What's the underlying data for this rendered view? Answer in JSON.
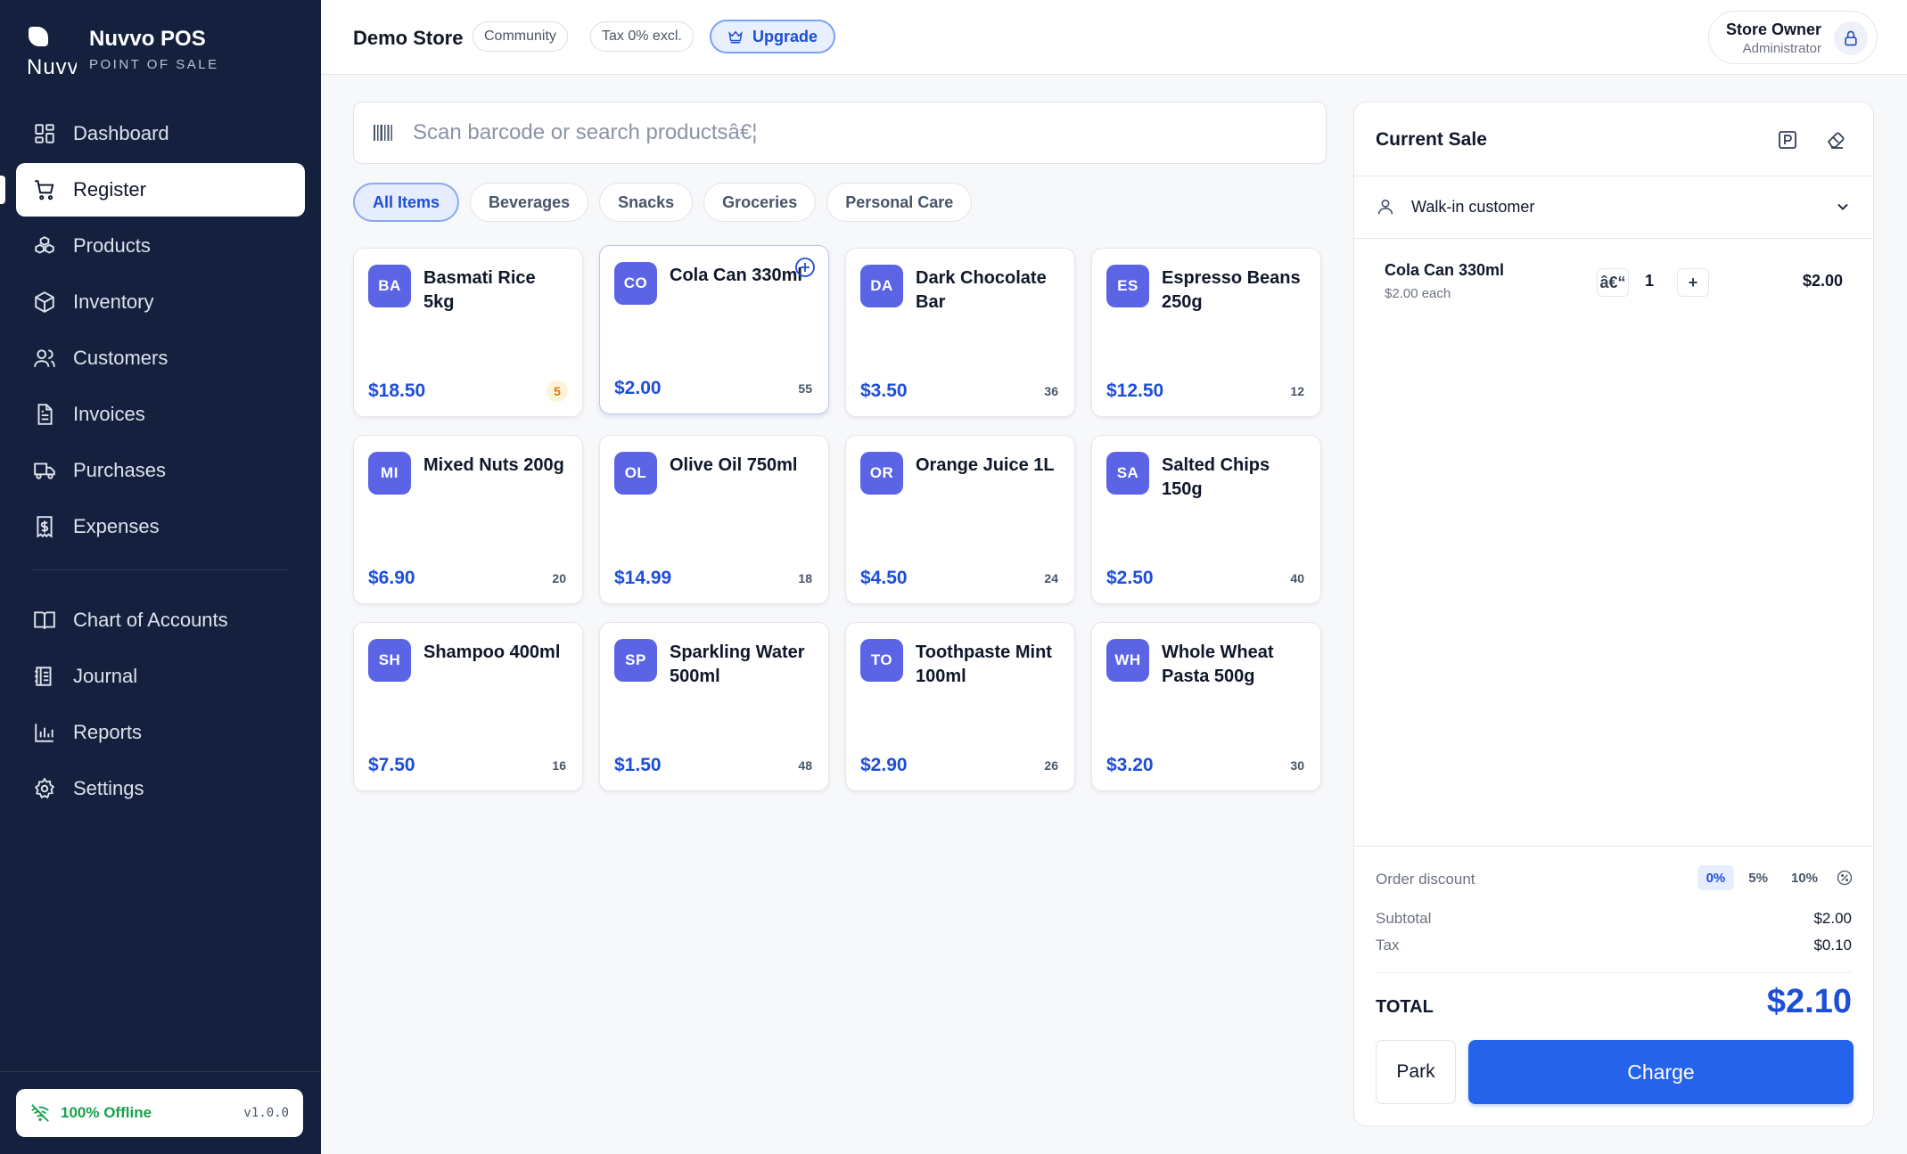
{
  "brand": {
    "logo_text": "Nuvv",
    "name": "Nuvvo POS",
    "subtitle": "POINT OF SALE"
  },
  "nav": [
    {
      "label": "Dashboard",
      "icon": "dashboard-icon",
      "active": false
    },
    {
      "label": "Register",
      "icon": "cart-icon",
      "active": true
    },
    {
      "label": "Products",
      "icon": "boxes-icon",
      "active": false
    },
    {
      "label": "Inventory",
      "icon": "package-icon",
      "active": false
    },
    {
      "label": "Customers",
      "icon": "users-icon",
      "active": false
    },
    {
      "label": "Invoices",
      "icon": "document-icon",
      "active": false
    },
    {
      "label": "Purchases",
      "icon": "truck-icon",
      "active": false
    },
    {
      "label": "Expenses",
      "icon": "receipt-dollar-icon",
      "active": false
    },
    {
      "label": "Chart of Accounts",
      "icon": "book-open-icon",
      "active": false
    },
    {
      "label": "Journal",
      "icon": "journal-icon",
      "active": false
    },
    {
      "label": "Reports",
      "icon": "bar-chart-icon",
      "active": false
    },
    {
      "label": "Settings",
      "icon": "gear-icon",
      "active": false
    }
  ],
  "status": {
    "offline_label": "100% Offline",
    "version": "v1.0.0",
    "color": "#16a34a"
  },
  "header": {
    "store_name": "Demo Store",
    "plan_badge": "Community",
    "tax_badge": "Tax 0% excl.",
    "upgrade_label": "Upgrade",
    "user_name": "Store Owner",
    "user_role": "Administrator"
  },
  "search": {
    "placeholder": "Scan barcode or search productsâ€¦",
    "value": ""
  },
  "categories": [
    {
      "label": "All Items",
      "active": true
    },
    {
      "label": "Beverages",
      "active": false
    },
    {
      "label": "Snacks",
      "active": false
    },
    {
      "label": "Groceries",
      "active": false
    },
    {
      "label": "Personal Care",
      "active": false
    }
  ],
  "products": [
    {
      "abbr": "BA",
      "name": "Basmati Rice 5kg",
      "price": "$18.50",
      "stock": "5",
      "low_stock": true
    },
    {
      "abbr": "CO",
      "name": "Cola Can 330ml",
      "price": "$2.00",
      "stock": "55",
      "hovered": true
    },
    {
      "abbr": "DA",
      "name": "Dark Chocolate Bar",
      "price": "$3.50",
      "stock": "36"
    },
    {
      "abbr": "ES",
      "name": "Espresso Beans 250g",
      "price": "$12.50",
      "stock": "12"
    },
    {
      "abbr": "MI",
      "name": "Mixed Nuts 200g",
      "price": "$6.90",
      "stock": "20"
    },
    {
      "abbr": "OL",
      "name": "Olive Oil 750ml",
      "price": "$14.99",
      "stock": "18"
    },
    {
      "abbr": "OR",
      "name": "Orange Juice 1L",
      "price": "$4.50",
      "stock": "24"
    },
    {
      "abbr": "SA",
      "name": "Salted Chips 150g",
      "price": "$2.50",
      "stock": "40"
    },
    {
      "abbr": "SH",
      "name": "Shampoo 400ml",
      "price": "$7.50",
      "stock": "16"
    },
    {
      "abbr": "SP",
      "name": "Sparkling Water 500ml",
      "price": "$1.50",
      "stock": "48"
    },
    {
      "abbr": "TO",
      "name": "Toothpaste Mint 100ml",
      "price": "$2.90",
      "stock": "26"
    },
    {
      "abbr": "WH",
      "name": "Whole Wheat Pasta 500g",
      "price": "$3.20",
      "stock": "30"
    }
  ],
  "sale": {
    "title": "Current Sale",
    "customer": "Walk-in customer",
    "items": [
      {
        "name": "Cola Can 330ml",
        "each": "$2.00 each",
        "minus_label": "â€“",
        "qty": "1",
        "plus_label": "+",
        "total": "$2.00"
      }
    ],
    "discount_label": "Order discount",
    "discount_options": [
      {
        "label": "0%",
        "active": true
      },
      {
        "label": "5%",
        "active": false
      },
      {
        "label": "10%",
        "active": false
      }
    ],
    "subtotal_label": "Subtotal",
    "subtotal": "$2.00",
    "tax_label": "Tax",
    "tax": "$0.10",
    "total_label": "TOTAL",
    "total": "$2.10",
    "park_label": "Park",
    "charge_label": "Charge"
  },
  "colors": {
    "sidebar": "#14203d",
    "accent": "#2563eb",
    "avatar": "#5b64e5"
  }
}
